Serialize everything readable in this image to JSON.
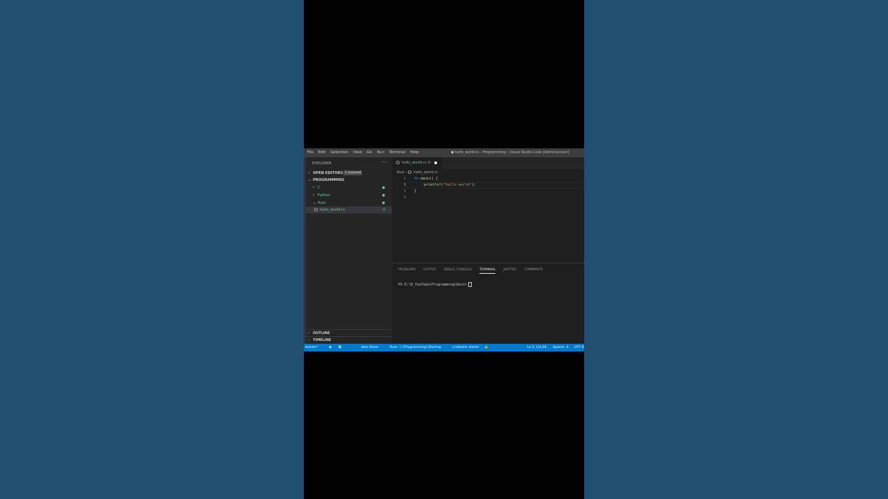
{
  "window": {
    "title": "● hello_world.rs - Programming - Visual Studio Code [Administrator]"
  },
  "menu": [
    "File",
    "Edit",
    "Selection",
    "View",
    "Go",
    "Run",
    "Terminal",
    "Help"
  ],
  "sidebar": {
    "header": "EXPLORER",
    "more": "···",
    "open_editors": "OPEN EDITORS",
    "unsaved_badge": "1 unsaved",
    "workspace": "PROGRAMMING",
    "folders": [
      {
        "label": "C",
        "expanded": false
      },
      {
        "label": "Python",
        "expanded": false
      },
      {
        "label": "Rust",
        "expanded": true
      }
    ],
    "file": {
      "label": "hello_world.rs",
      "status": "U"
    },
    "outline": "OUTLINE",
    "timeline": "TIMELINE"
  },
  "editor": {
    "tab": {
      "label": "hello_world.rs",
      "status": "U"
    },
    "breadcrumb": {
      "folder": "Rust",
      "file": "hello_world.rs"
    },
    "lines": [
      {
        "num": "1"
      },
      {
        "num": "2"
      },
      {
        "num": "3"
      },
      {
        "num": "4"
      }
    ],
    "code": {
      "fn_kw": "fn",
      "main": "main",
      "main_rest": "() {",
      "macro": "println!",
      "paren_open": "(",
      "string": "\"hello world\"",
      "paren_close": ");",
      "brace_close": "}"
    }
  },
  "panel": {
    "tabs": [
      "PROBLEMS",
      "OUTPUT",
      "DEBUG CONSOLE",
      "TERMINAL",
      "JUPYTER",
      "COMMENTS"
    ],
    "active_tab": "TERMINAL",
    "prompt": "PS E:\\0_YouTube\\Programming\\Rust>"
  },
  "statusbar": {
    "branch": "master*",
    "errors": "0",
    "warnings": "0",
    "live_share": "Live Share",
    "rust_status": "Rust: ⓘ [Programming] Starting",
    "tabnine": "⌂ tabnine starter",
    "position": "Ln 2, Col 28",
    "spaces": "Spaces: 4",
    "encoding": "UTF-8"
  },
  "colors": {
    "accent": "#007acc",
    "git_untracked": "#73c991",
    "background": "#1e1e1e"
  }
}
